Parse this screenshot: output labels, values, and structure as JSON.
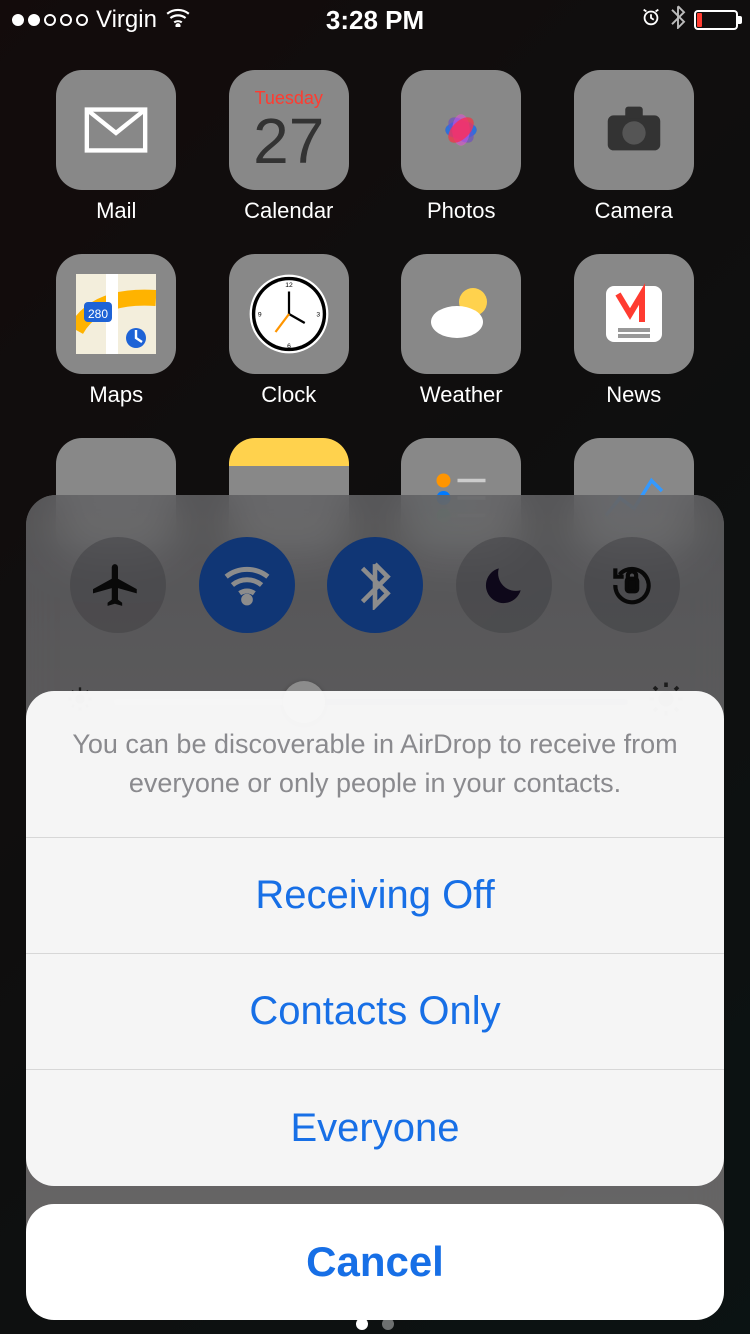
{
  "status": {
    "carrier": "Virgin",
    "time": "3:28 PM",
    "signal_dots_filled": 2,
    "battery_pct": 12
  },
  "calendar_tile": {
    "weekday": "Tuesday",
    "day": "27"
  },
  "apps": {
    "mail": "Mail",
    "calendar": "Calendar",
    "photos": "Photos",
    "camera": "Camera",
    "maps": "Maps",
    "clock": "Clock",
    "weather": "Weather",
    "news": "News"
  },
  "control_center": {
    "toggles": {
      "airplane": {
        "name": "airplane-mode",
        "on": false
      },
      "wifi": {
        "name": "wifi",
        "on": true
      },
      "bluetooth": {
        "name": "bluetooth",
        "on": true
      },
      "dnd": {
        "name": "do-not-disturb",
        "on": false
      },
      "rotation": {
        "name": "rotation-lock",
        "on": false
      }
    },
    "brightness_pct": 37
  },
  "airdrop_sheet": {
    "message": "You can be discoverable in AirDrop to receive from everyone or only people in your contacts.",
    "options": [
      "Receiving Off",
      "Contacts Only",
      "Everyone"
    ],
    "cancel": "Cancel"
  }
}
